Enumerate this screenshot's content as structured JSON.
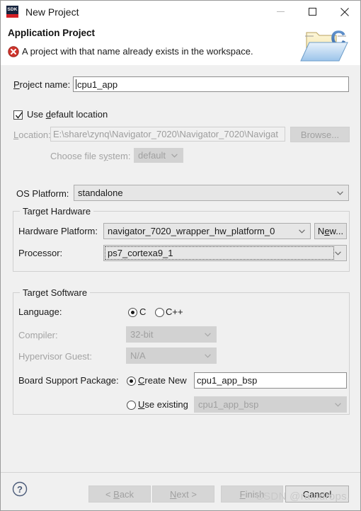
{
  "window": {
    "title": "New Project",
    "app_icon_text": "SDK",
    "minimize_label": "—",
    "maximize_label": "□",
    "close_label": "✕"
  },
  "header": {
    "title": "Application Project",
    "message": "A project with that name already exists in the workspace.",
    "error_color": "#d0342c",
    "icon": "c-folder-icon"
  },
  "form": {
    "project_name": {
      "label": "Project name:",
      "label_mnemonic": "P",
      "value": "cpu1_app"
    },
    "use_default_location": {
      "label": "Use default location",
      "label_mnemonic": "d",
      "checked": true
    },
    "location": {
      "label": "Location:",
      "label_mnemonic": "L",
      "value": "E:\\share\\zynq\\Navigator_7020\\Navigator_7020\\Navigat",
      "disabled": true
    },
    "browse_button": {
      "label": "Browse...",
      "label_mnemonic": "r",
      "disabled": true
    },
    "choose_file_system": {
      "label": "Choose file system:",
      "label_mnemonic": "y",
      "value": "default",
      "disabled": true
    },
    "os_platform": {
      "label": "OS Platform:",
      "value": "standalone"
    }
  },
  "target_hardware": {
    "group_title": "Target Hardware",
    "hardware_platform": {
      "label": "Hardware Platform:",
      "value": "navigator_7020_wrapper_hw_platform_0"
    },
    "new_button": {
      "label": "New...",
      "label_mnemonic": "e"
    },
    "processor": {
      "label": "Processor:",
      "value": "ps7_cortexa9_1",
      "focused": true
    }
  },
  "target_software": {
    "group_title": "Target Software",
    "language": {
      "label": "Language:",
      "options": [
        "C",
        "C++"
      ],
      "selected": "C"
    },
    "compiler": {
      "label": "Compiler:",
      "value": "32-bit",
      "disabled": true
    },
    "hypervisor_guest": {
      "label": "Hypervisor Guest:",
      "value": "N/A",
      "disabled": true
    },
    "board_support_package": {
      "label": "Board Support Package:",
      "create_new": {
        "label": "Create New",
        "label_mnemonic": "C",
        "selected": true,
        "value": "cpu1_app_bsp"
      },
      "use_existing": {
        "label": "Use existing",
        "label_mnemonic": "U",
        "selected": false,
        "value": "cpu1_app_bsp",
        "disabled": true
      }
    }
  },
  "footer": {
    "help_label": "?",
    "back_button": {
      "label": "< Back",
      "mnemonic": "B",
      "disabled": true
    },
    "next_button": {
      "label": "Next >",
      "mnemonic": "N",
      "disabled": true
    },
    "finish_button": {
      "label": "Finish",
      "mnemonic": "F",
      "disabled": true
    },
    "cancel_button": {
      "label": "Cancel",
      "disabled": false
    }
  },
  "watermark": {
    "text": "CSDN @raindrops."
  }
}
